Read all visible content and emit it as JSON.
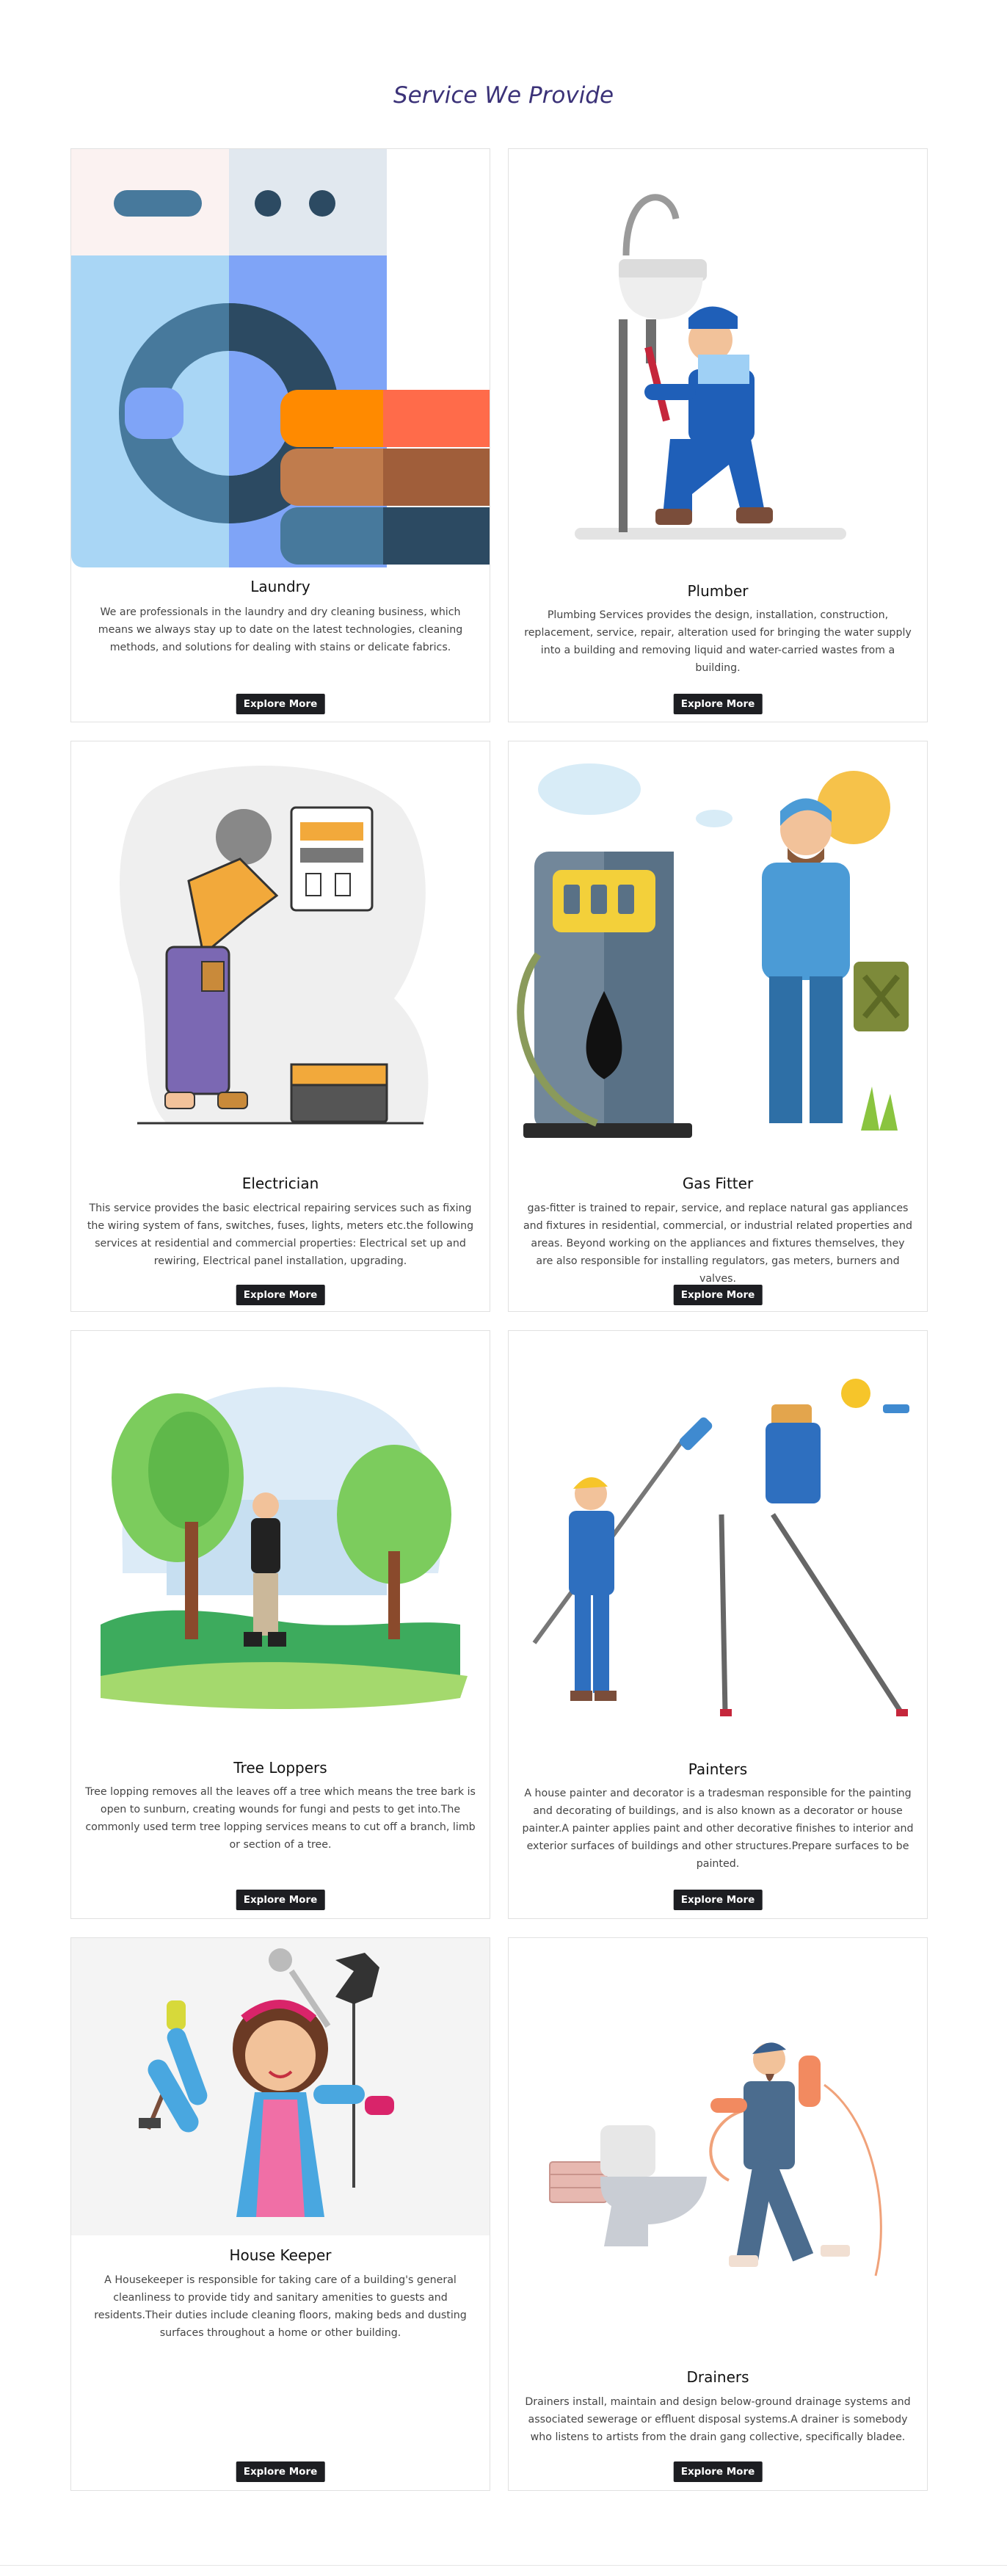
{
  "section": {
    "heading": "Service We Provide"
  },
  "cards": [
    {
      "title": "Laundry",
      "description": "We are professionals in the laundry and dry cleaning business, which means we always stay up to date on the latest technologies, cleaning methods, and solutions for dealing with stains or delicate fabrics.",
      "button": "Explore More",
      "image": "laundry-illustration"
    },
    {
      "title": "Plumber",
      "description": "Plumbing Services provides the design, installation, construction, replacement, service, repair, alteration used for bringing the water supply into a building and removing liquid and water-carried wastes from a building.",
      "button": "Explore More",
      "image": "plumber-illustration"
    },
    {
      "title": "Electrician",
      "description": "This service provides the basic electrical repairing services such as fixing the wiring system of fans, switches, fuses, lights, meters etc.the following services at residential and commercial properties: Electrical set up and rewiring, Electrical panel installation, upgrading.",
      "button": "Explore More",
      "image": "electrician-illustration"
    },
    {
      "title": "Gas Fitter",
      "description": "gas-fitter is trained to repair, service, and replace natural gas appliances and fixtures in residential, commercial, or industrial related properties and areas. Beyond working on the appliances and fixtures themselves, they are also responsible for installing regulators, gas meters, burners and valves.",
      "button": "Explore More",
      "image": "gas-fitter-illustration"
    },
    {
      "title": "Tree Loppers",
      "description": "Tree lopping removes all the leaves off a tree which means the tree bark is open to sunburn, creating wounds for fungi and pests to get into.The commonly used term tree lopping services means to cut off a branch, limb or section of a tree.",
      "button": "Explore More",
      "image": "tree-loppers-illustration"
    },
    {
      "title": "Painters",
      "description": "A house painter and decorator is a tradesman responsible for the painting and decorating of buildings, and is also known as a decorator or house painter.A painter applies paint and other decorative finishes to interior and exterior surfaces of buildings and other structures.Prepare surfaces to be painted.",
      "button": "Explore More",
      "image": "painters-illustration"
    },
    {
      "title": "House Keeper",
      "description": "A Housekeeper is responsible for taking care of a building's general cleanliness to provide tidy and sanitary amenities to guests and residents.Their duties include cleaning floors, making beds and dusting surfaces throughout a home or other building.",
      "button": "Explore More",
      "image": "house-keeper-illustration"
    },
    {
      "title": "Drainers",
      "description": "Drainers install, maintain and design below-ground drainage systems and associated sewerage or effluent disposal systems.A drainer is somebody who listens to artists from the drain gang collective, specifically bladee.",
      "button": "Explore More",
      "image": "drainers-illustration"
    }
  ]
}
